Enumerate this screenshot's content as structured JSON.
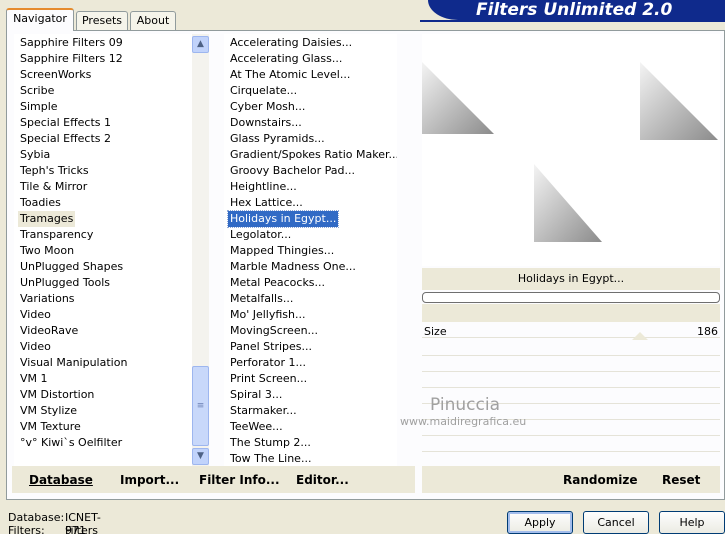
{
  "tabs": [
    {
      "label": "Navigator",
      "active": true
    },
    {
      "label": "Presets",
      "active": false
    },
    {
      "label": "About",
      "active": false
    }
  ],
  "banner": {
    "title": "Filters Unlimited 2.0"
  },
  "categories": [
    "Sapphire Filters 09",
    "Sapphire Filters 12",
    "ScreenWorks",
    "Scribe",
    "Simple",
    "Special Effects 1",
    "Special Effects 2",
    "Sybia",
    "Teph's Tricks",
    "Tile & Mirror",
    "Toadies",
    "Tramages",
    "Transparency",
    "Two Moon",
    "UnPlugged Shapes",
    "UnPlugged Tools",
    "Variations",
    "Video",
    "VideoRave",
    "Video",
    "Visual Manipulation",
    "VM 1",
    "VM Distortion",
    "VM Stylize",
    "VM Texture",
    "°v° Kiwi`s Oelfilter"
  ],
  "selected_category": "Tramages",
  "filters": [
    "Accelerating Daisies...",
    "Accelerating Glass...",
    "At The Atomic Level...",
    "Cirquelate...",
    "Cyber Mosh...",
    "Downstairs...",
    "Glass Pyramids...",
    "Gradient/Spokes Ratio Maker...",
    "Groovy Bachelor Pad...",
    "Heightline...",
    "Hex Lattice...",
    "Holidays in Egypt...",
    "Legolator...",
    "Mapped Thingies...",
    "Marble Madness One...",
    "Metal Peacocks...",
    "Metalfalls...",
    "Mo' Jellyfish...",
    "MovingScreen...",
    "Panel Stripes...",
    "Perforator 1...",
    "Print Screen...",
    "Spiral 3...",
    "Starmaker...",
    "TeeWee...",
    "The Stump 2...",
    "Tow The Line..."
  ],
  "selected_filter": "Holidays in Egypt...",
  "preview": {
    "filter_name": "Holidays in Egypt..."
  },
  "controls": [
    {
      "label": "Size",
      "value": "186"
    }
  ],
  "watermark": {
    "name": "Pinuccia",
    "url": "www.maidiregrafica.eu"
  },
  "toolbar": {
    "database": "Database",
    "import": "Import...",
    "filter_info": "Filter Info...",
    "editor": "Editor...",
    "randomize": "Randomize",
    "reset": "Reset"
  },
  "footer": {
    "database_label": "Database:",
    "database_value": "ICNET-Filters",
    "filters_label": "Filters:",
    "filters_value": "971"
  },
  "buttons": {
    "apply": "Apply",
    "cancel": "Cancel",
    "help": "Help"
  },
  "icons": {
    "scroll_up": "chevron-up-icon",
    "scroll_down": "chevron-down-icon",
    "scroll_grip": "grip-icon"
  },
  "colors": {
    "banner": "#0f2a8c",
    "selection": "#316ac5",
    "tab_accent": "#e68b2c"
  }
}
